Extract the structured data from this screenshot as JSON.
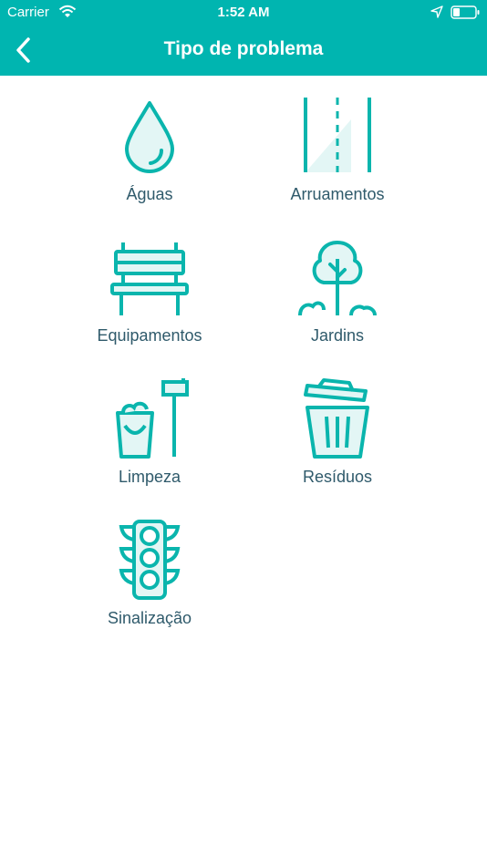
{
  "status_bar": {
    "carrier": "Carrier",
    "time": "1:52 AM",
    "icons": [
      "wifi-icon",
      "location-arrow-icon",
      "battery-icon"
    ]
  },
  "nav": {
    "title": "Tipo de problema",
    "back_icon": "chevron-left-icon"
  },
  "colors": {
    "primary": "#00b5b0",
    "icon": "#0ab5ad",
    "icon_fill": "#e3f6f5",
    "label": "#2f5a6b"
  },
  "categories": [
    {
      "label": "Águas",
      "icon": "water-drop-icon"
    },
    {
      "label": "Arruamentos",
      "icon": "road-icon"
    },
    {
      "label": "Equipamentos",
      "icon": "bench-icon"
    },
    {
      "label": "Jardins",
      "icon": "tree-icon"
    },
    {
      "label": "Limpeza",
      "icon": "bucket-mop-icon"
    },
    {
      "label": "Resíduos",
      "icon": "trash-bin-icon"
    },
    {
      "label": "Sinalização",
      "icon": "traffic-light-icon"
    }
  ]
}
